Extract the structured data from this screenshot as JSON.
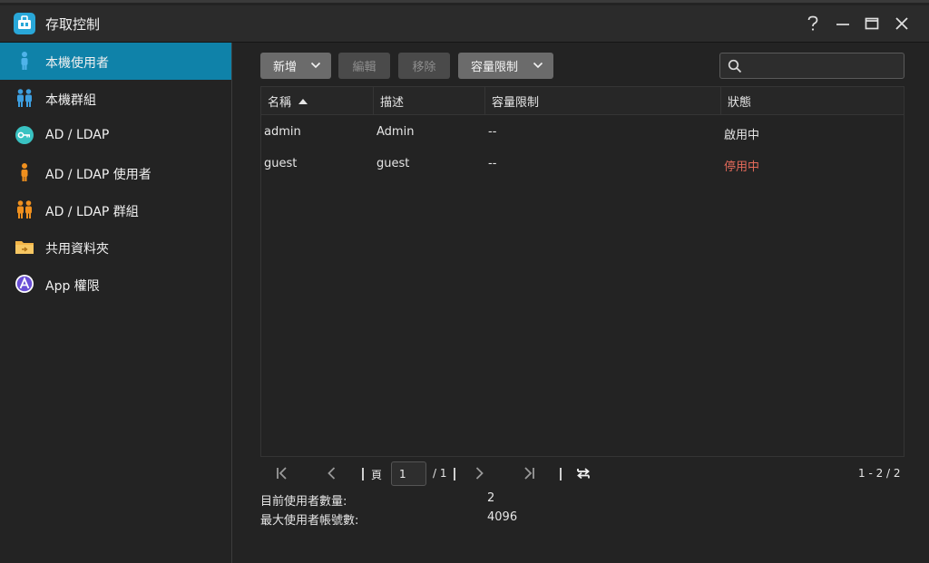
{
  "window": {
    "title": "存取控制"
  },
  "sidebar": {
    "items": [
      {
        "label": "本機使用者",
        "icon": "user-icon",
        "active": true
      },
      {
        "label": "本機群組",
        "icon": "user-group-icon"
      },
      {
        "label": "AD / LDAP",
        "icon": "key-icon"
      },
      {
        "label": "AD / LDAP 使用者",
        "icon": "user-icon"
      },
      {
        "label": "AD / LDAP 群組",
        "icon": "user-group-icon"
      },
      {
        "label": "共用資料夾",
        "icon": "shared-folder-icon"
      },
      {
        "label": "App 權限",
        "icon": "app-permission-icon"
      }
    ]
  },
  "toolbar": {
    "add_label": "新增",
    "edit_label": "編輯",
    "remove_label": "移除",
    "quota_label": "容量限制",
    "search_placeholder": ""
  },
  "table": {
    "columns": [
      "名稱",
      "描述",
      "容量限制",
      "狀態"
    ],
    "rows": [
      {
        "name": "admin",
        "description": "Admin",
        "quota": "--",
        "status": "啟用中"
      },
      {
        "name": "guest",
        "description": "guest",
        "quota": "--",
        "status": "停用中"
      }
    ]
  },
  "pager": {
    "page_label": "頁",
    "current_page": "1",
    "total_pages": "/ 1",
    "range": "1 - 2 / 2"
  },
  "stats": {
    "current_users_label": "目前使用者數量:",
    "current_users_value": "2",
    "max_users_label": "最大使用者帳號數:",
    "max_users_value": "4096"
  },
  "colors": {
    "accent": "#0f82a9",
    "disabled_status": "#e36a5a"
  }
}
